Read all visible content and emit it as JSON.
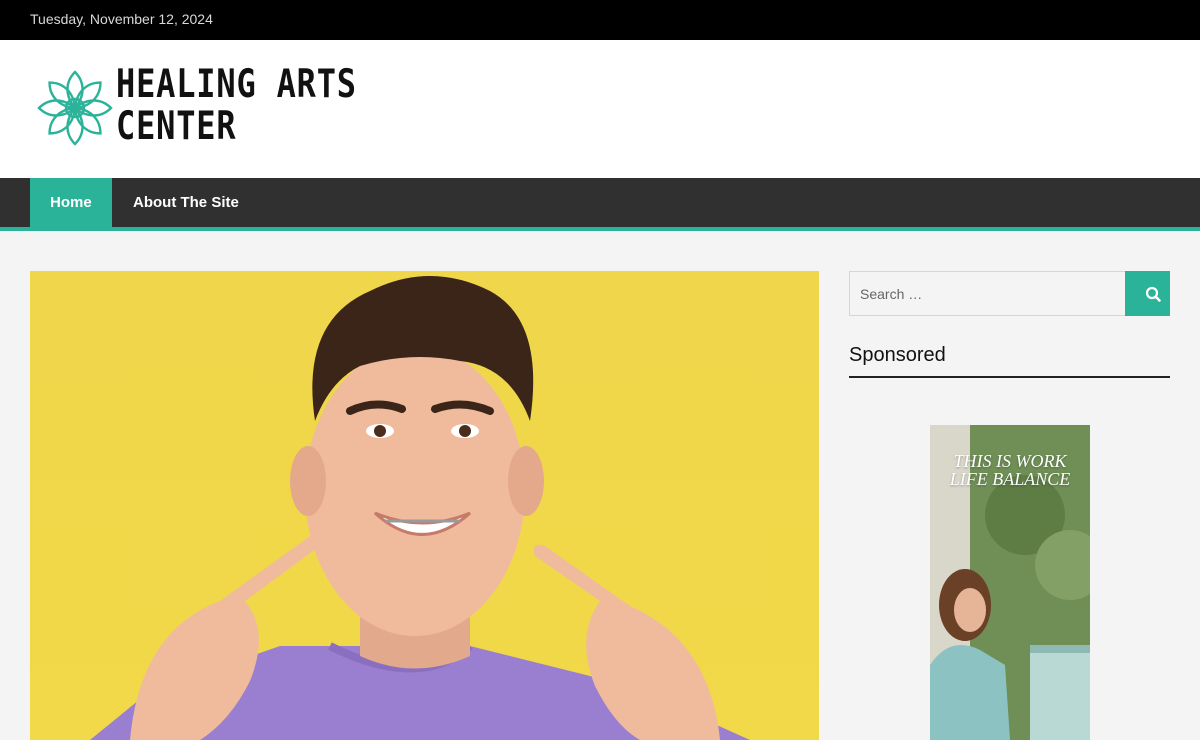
{
  "topbar": {
    "date": "Tuesday, November 12, 2024"
  },
  "brand": {
    "line1": "HEALING ARTS",
    "line2": "CENTER",
    "accent": "#2bb39a",
    "icon": "lotus-icon"
  },
  "nav": {
    "items": [
      {
        "label": "Home",
        "active": true
      },
      {
        "label": "About The Site",
        "active": false
      }
    ]
  },
  "search": {
    "placeholder": "Search …",
    "icon": "search-icon"
  },
  "sidebar": {
    "widget_title": "Sponsored",
    "ad": {
      "line1": "THIS IS WORK",
      "line2": "LIFE BALANCE"
    }
  },
  "colors": {
    "topbar": "#000000",
    "nav": "#303030",
    "accent": "#2bb39a",
    "hero_bg": "#efd64a"
  }
}
